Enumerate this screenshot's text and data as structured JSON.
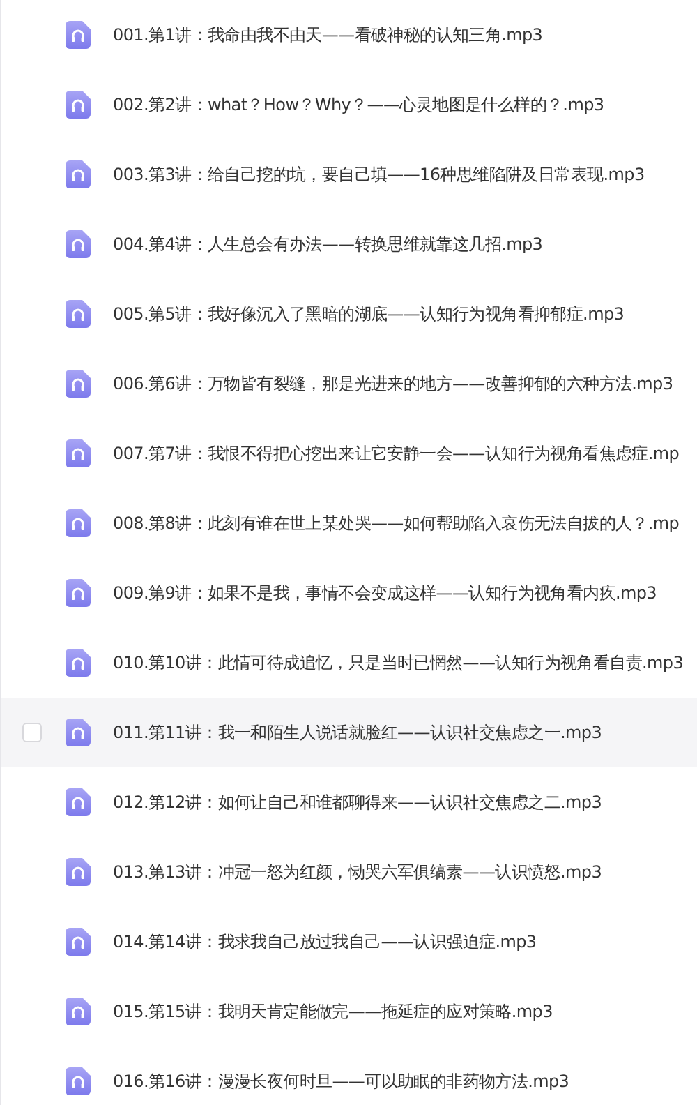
{
  "files": [
    {
      "name": "001.第1讲：我命由我不由天——看破神秘的认知三角.mp3",
      "hovered": false
    },
    {
      "name": "002.第2讲：what？How？Why？——心灵地图是什么样的？.mp3",
      "hovered": false
    },
    {
      "name": "003.第3讲：给自己挖的坑，要自己填——16种思维陷阱及日常表现.mp3",
      "hovered": false
    },
    {
      "name": "004.第4讲：人生总会有办法——转换思维就靠这几招.mp3",
      "hovered": false
    },
    {
      "name": "005.第5讲：我好像沉入了黑暗的湖底——认知行为视角看抑郁症.mp3",
      "hovered": false
    },
    {
      "name": "006.第6讲：万物皆有裂缝，那是光进来的地方——改善抑郁的六种方法.mp3",
      "hovered": false
    },
    {
      "name": "007.第7讲：我恨不得把心挖出来让它安静一会——认知行为视角看焦虑症.mp",
      "hovered": false
    },
    {
      "name": "008.第8讲：此刻有谁在世上某处哭——如何帮助陷入哀伤无法自拔的人？.mp",
      "hovered": false
    },
    {
      "name": "009.第9讲：如果不是我，事情不会变成这样——认知行为视角看内疚.mp3",
      "hovered": false
    },
    {
      "name": "010.第10讲：此情可待成追忆，只是当时已惘然——认知行为视角看自责.mp3",
      "hovered": false
    },
    {
      "name": "011.第11讲：我一和陌生人说话就脸红——认识社交焦虑之一.mp3",
      "hovered": true
    },
    {
      "name": "012.第12讲：如何让自己和谁都聊得来——认识社交焦虑之二.mp3",
      "hovered": false
    },
    {
      "name": "013.第13讲：冲冠一怒为红颜，恸哭六军俱缟素——认识愤怒.mp3",
      "hovered": false
    },
    {
      "name": "014.第14讲：我求我自己放过我自己——认识强迫症.mp3",
      "hovered": false
    },
    {
      "name": "015.第15讲：我明天肯定能做完——拖延症的应对策略.mp3",
      "hovered": false
    },
    {
      "name": "016.第16讲：漫漫长夜何时旦——可以助眠的非药物方法.mp3",
      "hovered": false
    }
  ]
}
